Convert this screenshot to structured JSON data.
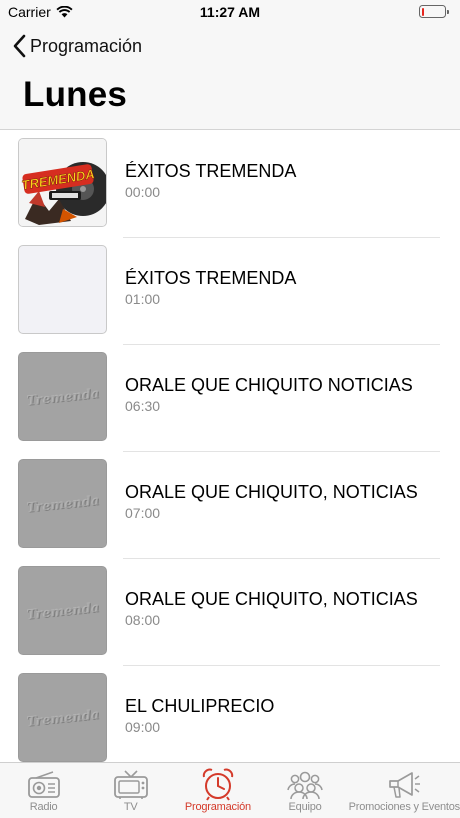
{
  "status": {
    "carrier": "Carrier",
    "time": "11:27 AM",
    "battery_level": 0.1
  },
  "nav": {
    "back_label": "Programación",
    "title": "Lunes"
  },
  "schedule": [
    {
      "title": "ÉXITOS TREMENDA",
      "time": "00:00",
      "thumb": "logo-color"
    },
    {
      "title": "ÉXITOS TREMENDA",
      "time": "01:00",
      "thumb": "blank"
    },
    {
      "title": "ORALE QUE CHIQUITO NOTICIAS",
      "time": "06:30",
      "thumb": "logo-gray"
    },
    {
      "title": "ORALE QUE CHIQUITO, NOTICIAS",
      "time": "07:00",
      "thumb": "logo-gray"
    },
    {
      "title": "ORALE QUE CHIQUITO, NOTICIAS",
      "time": "08:00",
      "thumb": "logo-gray"
    },
    {
      "title": "EL CHULIPRECIO",
      "time": "09:00",
      "thumb": "logo-gray"
    }
  ],
  "logo_text": {
    "color": "TREMENDA",
    "gray": "Tremenda"
  },
  "tabs": [
    {
      "label": "Radio",
      "icon": "radio-icon",
      "active": false
    },
    {
      "label": "TV",
      "icon": "tv-icon",
      "active": false
    },
    {
      "label": "Programación",
      "icon": "alarm-clock-icon",
      "active": true
    },
    {
      "label": "Equipo",
      "icon": "team-icon",
      "active": false
    },
    {
      "label": "Promociones y Eventos",
      "icon": "megaphone-icon",
      "active": false
    }
  ],
  "colors": {
    "accent": "#d43a2a",
    "inactive": "#8e8e8e",
    "battery": "#e5251e"
  }
}
